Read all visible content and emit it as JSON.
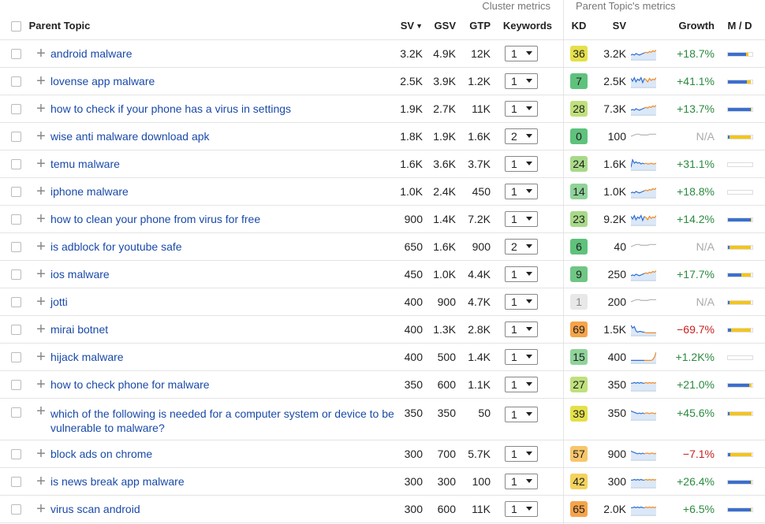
{
  "groups": {
    "cluster": "Cluster metrics",
    "parent": "Parent Topic's metrics"
  },
  "columns": {
    "parent_topic": "Parent Topic",
    "sv": "SV",
    "gsv": "GSV",
    "gtp": "GTP",
    "keywords": "Keywords",
    "kd": "KD",
    "sv2": "SV",
    "growth": "Growth",
    "md": "M / D"
  },
  "colors": {
    "link": "#1a4aa8",
    "positive": "#2a8a3e",
    "negative": "#c81e1e",
    "mobile": "#3a6fd0",
    "desktop": "#f5c518"
  },
  "rows": [
    {
      "topic": "android malware",
      "sv": "3.2K",
      "gsv": "4.9K",
      "gtp": "12K",
      "kw": "1",
      "kd": "36",
      "kd_color": "#e4e04a",
      "psv": "3.2K",
      "growth": "+18.7%",
      "gtype": "pos",
      "mobile": 0.75,
      "desktop": 0.1,
      "spark": "trend"
    },
    {
      "topic": "lovense app malware",
      "sv": "2.5K",
      "gsv": "3.9K",
      "gtp": "1.2K",
      "kw": "1",
      "kd": "7",
      "kd_color": "#5fc27c",
      "psv": "2.5K",
      "growth": "+41.1%",
      "gtype": "pos",
      "mobile": 0.8,
      "desktop": 0.15,
      "spark": "volatile"
    },
    {
      "topic": "how to check if your phone has a virus in settings",
      "sv": "1.9K",
      "gsv": "2.7K",
      "gtp": "11K",
      "kw": "1",
      "kd": "28",
      "kd_color": "#bfe07c",
      "psv": "7.3K",
      "growth": "+13.7%",
      "gtype": "pos",
      "mobile": 0.95,
      "desktop": 0.03,
      "spark": "trend"
    },
    {
      "topic": "wise anti malware download apk",
      "sv": "1.8K",
      "gsv": "1.9K",
      "gtp": "1.6K",
      "kw": "2",
      "kd": "0",
      "kd_color": "#5fc27c",
      "psv": "100",
      "growth": "N/A",
      "gtype": "na",
      "mobile": 0.08,
      "desktop": 0.88,
      "spark": "gray"
    },
    {
      "topic": "temu malware",
      "sv": "1.6K",
      "gsv": "3.6K",
      "gtp": "3.7K",
      "kw": "1",
      "kd": "24",
      "kd_color": "#a8d988",
      "psv": "1.6K",
      "growth": "+31.1%",
      "gtype": "pos",
      "mobile": 0.0,
      "desktop": 0.0,
      "spark": "spike-left"
    },
    {
      "topic": "iphone malware",
      "sv": "1.0K",
      "gsv": "2.4K",
      "gtp": "450",
      "kw": "1",
      "kd": "14",
      "kd_color": "#8fd39a",
      "psv": "1.0K",
      "growth": "+18.8%",
      "gtype": "pos",
      "mobile": 0.0,
      "desktop": 0.0,
      "spark": "trend"
    },
    {
      "topic": "how to clean your phone from virus for free",
      "sv": "900",
      "gsv": "1.4K",
      "gtp": "7.2K",
      "kw": "1",
      "kd": "23",
      "kd_color": "#a8d988",
      "psv": "9.2K",
      "growth": "+14.2%",
      "gtype": "pos",
      "mobile": 0.95,
      "desktop": 0.03,
      "spark": "volatile"
    },
    {
      "topic": "is adblock for youtube safe",
      "sv": "650",
      "gsv": "1.6K",
      "gtp": "900",
      "kw": "2",
      "kd": "6",
      "kd_color": "#5fc27c",
      "psv": "40",
      "growth": "N/A",
      "gtype": "na",
      "mobile": 0.08,
      "desktop": 0.88,
      "spark": "gray"
    },
    {
      "topic": "ios malware",
      "sv": "450",
      "gsv": "1.0K",
      "gtp": "4.4K",
      "kw": "1",
      "kd": "9",
      "kd_color": "#6fc684",
      "psv": "250",
      "growth": "+17.7%",
      "gtype": "pos",
      "mobile": 0.55,
      "desktop": 0.4,
      "spark": "trend"
    },
    {
      "topic": "jotti",
      "sv": "400",
      "gsv": "900",
      "gtp": "4.7K",
      "kw": "1",
      "kd": "1",
      "kd_color": "#e8e8e8",
      "psv": "200",
      "growth": "N/A",
      "gtype": "na",
      "mobile": 0.08,
      "desktop": 0.88,
      "spark": "gray"
    },
    {
      "topic": "mirai botnet",
      "sv": "400",
      "gsv": "1.3K",
      "gtp": "2.8K",
      "kw": "1",
      "kd": "69",
      "kd_color": "#f5a44a",
      "psv": "1.5K",
      "growth": "−69.7%",
      "gtype": "neg",
      "mobile": 0.15,
      "desktop": 0.8,
      "spark": "decline"
    },
    {
      "topic": "hijack malware",
      "sv": "400",
      "gsv": "500",
      "gtp": "1.4K",
      "kw": "1",
      "kd": "15",
      "kd_color": "#8fd39a",
      "psv": "400",
      "growth": "+1.2K%",
      "gtype": "pos",
      "mobile": 0.0,
      "desktop": 0.0,
      "spark": "spike-right"
    },
    {
      "topic": "how to check phone for malware",
      "sv": "350",
      "gsv": "600",
      "gtp": "1.1K",
      "kw": "1",
      "kd": "27",
      "kd_color": "#bfe07c",
      "psv": "350",
      "growth": "+21.0%",
      "gtype": "pos",
      "mobile": 0.9,
      "desktop": 0.08,
      "spark": "flat"
    },
    {
      "topic": "which of the following is needed for a computer system or device to be vulnerable to malware?",
      "sv": "350",
      "gsv": "350",
      "gtp": "50",
      "kw": "1",
      "kd": "39",
      "kd_color": "#e4e04a",
      "psv": "350",
      "growth": "+45.6%",
      "gtype": "pos",
      "mobile": 0.08,
      "desktop": 0.9,
      "spark": "decline-soft",
      "tall": true
    },
    {
      "topic": "block ads on chrome",
      "sv": "300",
      "gsv": "700",
      "gtp": "5.7K",
      "kw": "1",
      "kd": "57",
      "kd_color": "#f7c66a",
      "psv": "900",
      "growth": "−7.1%",
      "gtype": "neg",
      "mobile": 0.12,
      "desktop": 0.85,
      "spark": "decline-soft"
    },
    {
      "topic": "is news break app malware",
      "sv": "300",
      "gsv": "300",
      "gtp": "100",
      "kw": "1",
      "kd": "42",
      "kd_color": "#f3d35c",
      "psv": "300",
      "growth": "+26.4%",
      "gtype": "pos",
      "mobile": 0.95,
      "desktop": 0.03,
      "spark": "flat"
    },
    {
      "topic": "virus scan android",
      "sv": "300",
      "gsv": "600",
      "gtp": "11K",
      "kw": "1",
      "kd": "65",
      "kd_color": "#f5a44a",
      "psv": "2.0K",
      "growth": "+6.5%",
      "gtype": "pos",
      "mobile": 0.95,
      "desktop": 0.03,
      "spark": "flat"
    }
  ]
}
